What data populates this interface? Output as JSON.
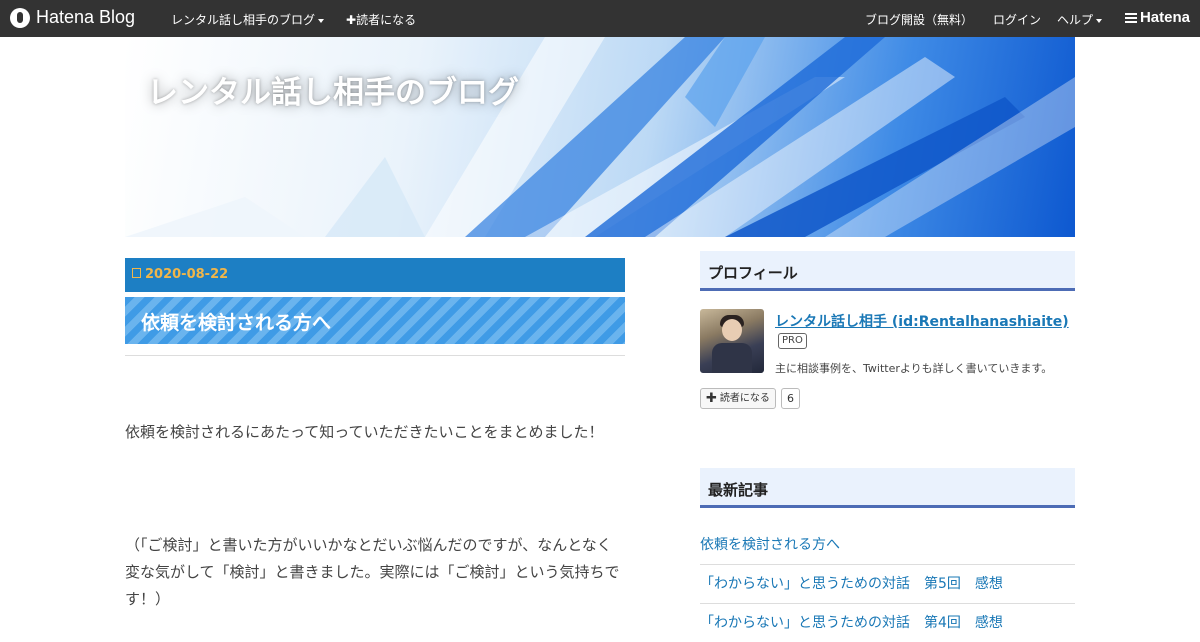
{
  "topbar": {
    "logo": "Hatena Blog",
    "blog_menu": "レンタル話し相手のブログ",
    "subscribe": "読者になる",
    "open_blog": "ブログ開設（無料）",
    "login": "ログイン",
    "help": "ヘルプ",
    "hatena": "Hatena"
  },
  "header": {
    "title": "レンタル話し相手のブログ"
  },
  "entry": {
    "date": "2020-08-22",
    "title": "依頼を検討される方へ",
    "paragraphs": [
      "依頼を検討されるにあたって知っていただきたいことをまとめました！",
      "（「ご検討」と書いた方がいいかなとだいぶ悩んだのですが、なんとなく変な気がして「検討」と書きました。実際には「ご検討」という気持ちです！）"
    ]
  },
  "sidebar": {
    "profile_heading": "プロフィール",
    "profile_name": "レンタル話し相手 (id:Rentalhanashiaite)",
    "pro_badge": "PRO",
    "profile_desc": "主に相談事例を、Twitterよりも詳しく書いていきます。",
    "subscribe_label": "読者になる",
    "subscriber_count": "6",
    "recent_heading": "最新記事",
    "recent": [
      "依頼を検討される方へ",
      "「わからない」と思うための対話　第5回　感想",
      "「わからない」と思うための対話　第4回　感想"
    ]
  },
  "colors": {
    "topbar": "#333333",
    "date_bar": "#1d7fc4",
    "date_text": "#f0b64a",
    "title_stripe": "#3f9be6",
    "link": "#1a78b6",
    "sidebar_rule": "#4d6cb5"
  }
}
